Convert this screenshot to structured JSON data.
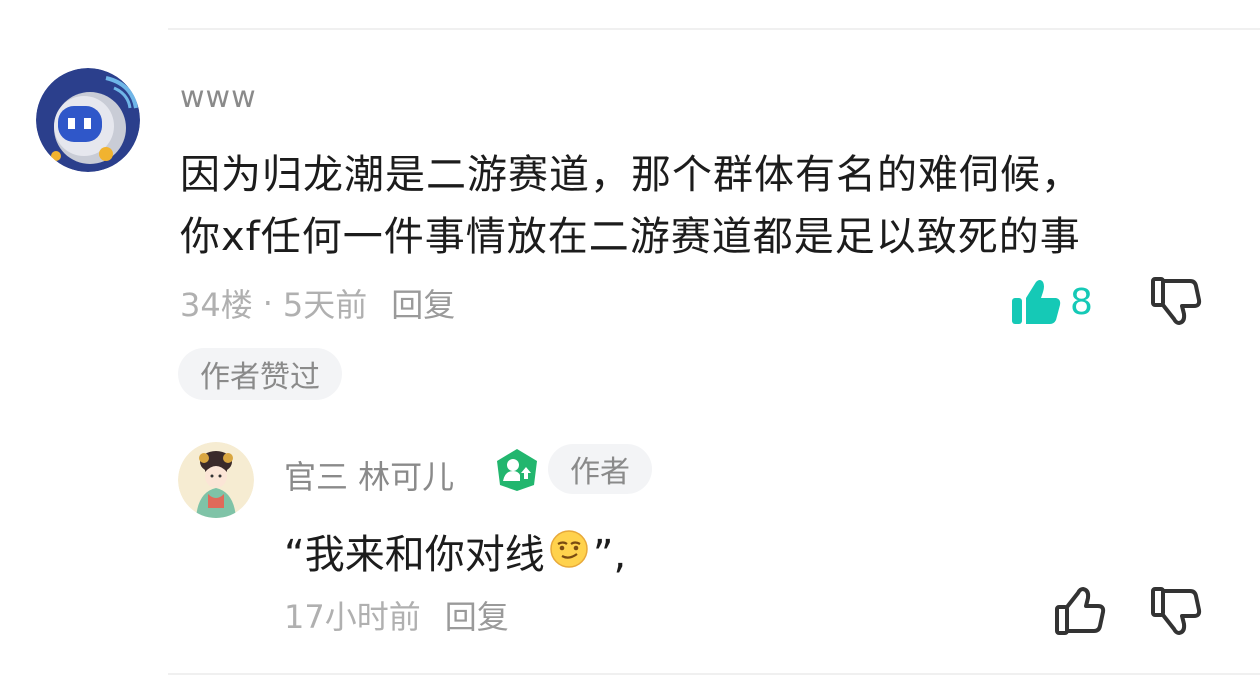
{
  "comment": {
    "username": "www",
    "text_line1": "因为归龙潮是二游赛道，那个群体有名的难伺候，",
    "text_line2": "你xf任何一件事情放在二游赛道都是足以致死的事",
    "floor": "34楼",
    "separator": "·",
    "time": "5天前",
    "reply_label": "回复",
    "like_count": "8",
    "liked": true,
    "badge": "作者赞过",
    "like_color": "#15c9b6"
  },
  "reply": {
    "username": "官三 林可儿",
    "author_tag": "作者",
    "text_before": "“我来和你对线",
    "emoji": "smirk-emoji",
    "text_after": "”,",
    "time": "17小时前",
    "reply_label": "回复"
  }
}
